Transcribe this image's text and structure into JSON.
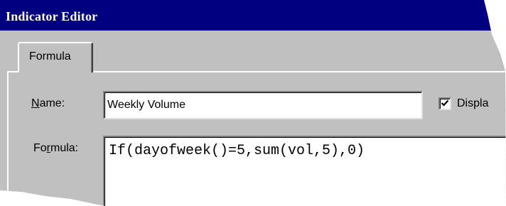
{
  "window": {
    "title": "Indicator Editor"
  },
  "tabs": [
    {
      "label": "Formula",
      "selected": true
    }
  ],
  "fields": {
    "name": {
      "label_mnemonic": "N",
      "label_rest": "ame:",
      "value": "Weekly Volume"
    },
    "formula": {
      "label_before": "Fo",
      "label_mnemonic": "r",
      "label_after": "mula:",
      "value": "If(dayofweek()=5,sum(vol,5),0)"
    }
  },
  "display_checkbox": {
    "label": "Displa",
    "checked": true
  },
  "colors": {
    "title_bar": "#000080",
    "face": "#c0c0c0"
  }
}
